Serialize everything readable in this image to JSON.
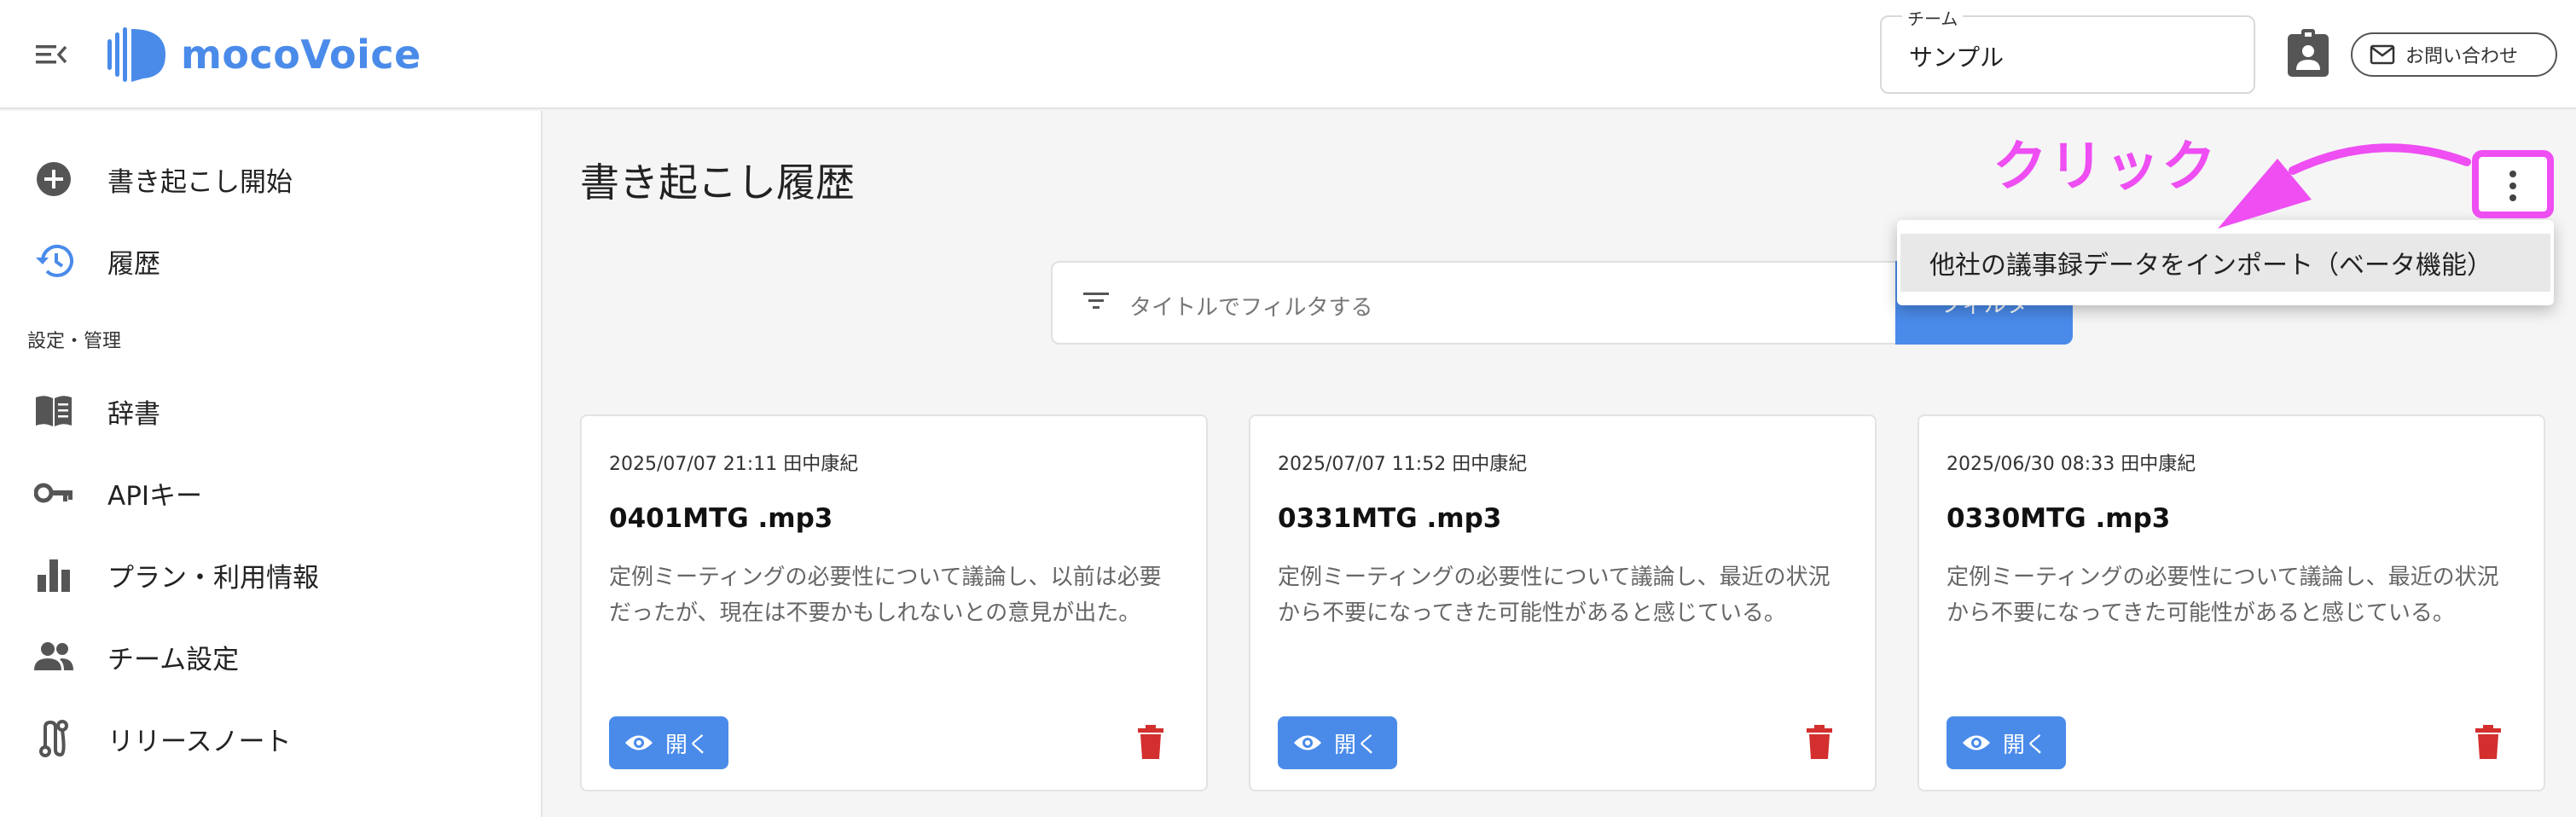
{
  "app": {
    "name": "mocoVoice"
  },
  "header": {
    "team_label": "チーム",
    "team_value": "サンプル",
    "contact_label": "お問い合わせ",
    "brand_color": "#4a8bea"
  },
  "sidebar": {
    "items": [
      {
        "label": "書き起こし開始",
        "icon": "add-circle-icon"
      },
      {
        "label": "履歴",
        "icon": "history-icon"
      }
    ],
    "section_label": "設定・管理",
    "settings_items": [
      {
        "label": "辞書",
        "icon": "book-icon"
      },
      {
        "label": "APIキー",
        "icon": "key-icon"
      },
      {
        "label": "プラン・利用情報",
        "icon": "bar-chart-icon"
      },
      {
        "label": "チーム設定",
        "icon": "people-icon"
      },
      {
        "label": "リリースノート",
        "icon": "route-icon"
      }
    ]
  },
  "main": {
    "title": "書き起こし履歴",
    "filter_placeholder": "タイトルでフィルタする",
    "filter_button": "フィルタ",
    "menu_item": "他社の議事録データをインポート（ベータ機能）",
    "annotation": "クリック",
    "annotation_color": "#ee4ef2"
  },
  "cards": [
    {
      "meta": "2025/07/07 21:11 田中康紀",
      "title": "0401MTG .mp3",
      "summary": "定例ミーティングの必要性について議論し、以前は必要だったが、現在は不要かもしれないとの意見が出た。",
      "open_label": "開く"
    },
    {
      "meta": "2025/07/07 11:52 田中康紀",
      "title": "0331MTG .mp3",
      "summary": "定例ミーティングの必要性について議論し、最近の状況から不要になってきた可能性があると感じている。",
      "open_label": "開く"
    },
    {
      "meta": "2025/06/30 08:33 田中康紀",
      "title": "0330MTG .mp3",
      "summary": "定例ミーティングの必要性について議論し、最近の状況から不要になってきた可能性があると感じている。",
      "open_label": "開く"
    }
  ]
}
